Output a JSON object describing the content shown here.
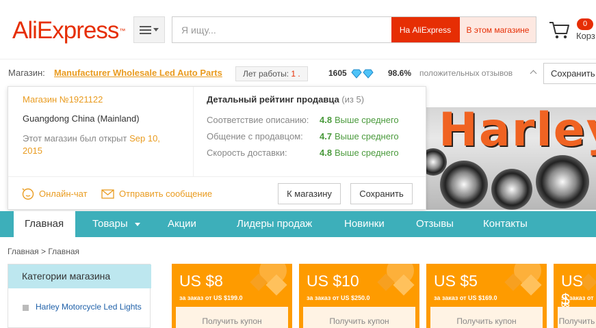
{
  "header": {
    "logo": "AliExpress",
    "logo_tm": "™",
    "search": {
      "placeholder": "Я ищу...",
      "btn_aliexpress": "На AliExpress",
      "btn_store": "В этом магазине"
    },
    "cart": {
      "count": "0",
      "label": "Корз"
    }
  },
  "store_bar": {
    "label": "Магазин:",
    "name": "Manufacturer Wholesale Led Auto Parts",
    "years_label": "Лет работы:",
    "years_value": "1 .",
    "score": "1605",
    "positive_pct": "98.6%",
    "positive_label": "положительных отзывов",
    "save": "Сохранить"
  },
  "popup": {
    "store_no": "Магазин №1921122",
    "location": "Guangdong China (Mainland)",
    "opened_prefix": "Этот магазин был открыт",
    "opened_date": "Sep 10, 2015",
    "rating_title": "Детальный рейтинг продавца",
    "rating_of": "(из 5)",
    "ratings": [
      {
        "label": "Соответствие описанию:",
        "value": "4.8",
        "note": "Выше среднего"
      },
      {
        "label": "Общение с продавцом:",
        "value": "4.7",
        "note": "Выше среднего"
      },
      {
        "label": "Скорость доставки:",
        "value": "4.8",
        "note": "Выше среднего"
      }
    ],
    "chat": "Онлайн-чат",
    "message": "Отправить сообщение",
    "to_store": "К магазину",
    "save": "Сохранить"
  },
  "banner": {
    "text": "Harley"
  },
  "nav": {
    "items": [
      "Главная",
      "Товары",
      "Акции",
      "Лидеры продаж",
      "Новинки",
      "Отзывы",
      "Контакты"
    ]
  },
  "breadcrumb": "Главная > Главная",
  "categories": {
    "title": "Категории магазина",
    "items": [
      "Harley Motorcycle Led Lights"
    ]
  },
  "coupons": [
    {
      "amount": "US $8",
      "condition": "за заказ от US $199.0",
      "action": "Получить купон"
    },
    {
      "amount": "US $10",
      "condition": "за заказ от US $250.0",
      "action": "Получить купон"
    },
    {
      "amount": "US $5",
      "condition": "за заказ от US $169.0",
      "action": "Получить купон"
    },
    {
      "amount": "US $",
      "condition": "за заказ от US",
      "action": "Получить купон"
    }
  ],
  "colors": {
    "brand_red": "#e62e04",
    "nav_teal": "#3dafba",
    "coupon_orange": "#fe9b00",
    "rating_green": "#4a9a3c"
  }
}
